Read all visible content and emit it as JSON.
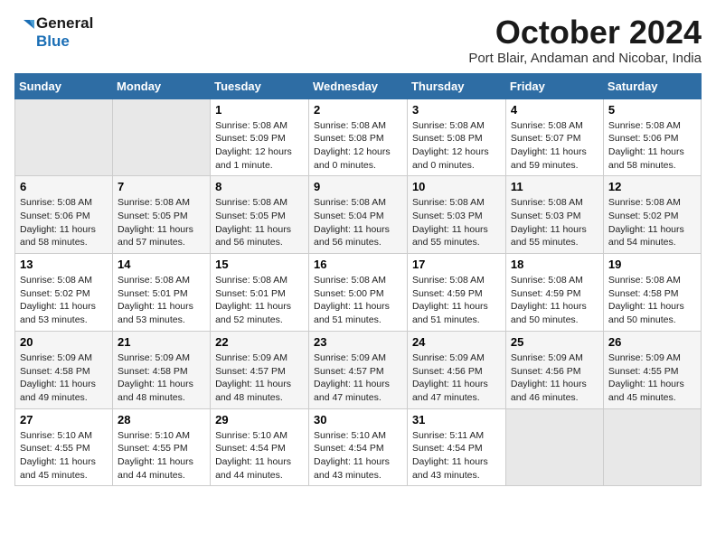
{
  "logo": {
    "line1": "General",
    "line2": "Blue"
  },
  "title": "October 2024",
  "subtitle": "Port Blair, Andaman and Nicobar, India",
  "days_header": [
    "Sunday",
    "Monday",
    "Tuesday",
    "Wednesday",
    "Thursday",
    "Friday",
    "Saturday"
  ],
  "weeks": [
    [
      {
        "day": "",
        "info": ""
      },
      {
        "day": "",
        "info": ""
      },
      {
        "day": "1",
        "info": "Sunrise: 5:08 AM\nSunset: 5:09 PM\nDaylight: 12 hours\nand 1 minute."
      },
      {
        "day": "2",
        "info": "Sunrise: 5:08 AM\nSunset: 5:08 PM\nDaylight: 12 hours\nand 0 minutes."
      },
      {
        "day": "3",
        "info": "Sunrise: 5:08 AM\nSunset: 5:08 PM\nDaylight: 12 hours\nand 0 minutes."
      },
      {
        "day": "4",
        "info": "Sunrise: 5:08 AM\nSunset: 5:07 PM\nDaylight: 11 hours\nand 59 minutes."
      },
      {
        "day": "5",
        "info": "Sunrise: 5:08 AM\nSunset: 5:06 PM\nDaylight: 11 hours\nand 58 minutes."
      }
    ],
    [
      {
        "day": "6",
        "info": "Sunrise: 5:08 AM\nSunset: 5:06 PM\nDaylight: 11 hours\nand 58 minutes."
      },
      {
        "day": "7",
        "info": "Sunrise: 5:08 AM\nSunset: 5:05 PM\nDaylight: 11 hours\nand 57 minutes."
      },
      {
        "day": "8",
        "info": "Sunrise: 5:08 AM\nSunset: 5:05 PM\nDaylight: 11 hours\nand 56 minutes."
      },
      {
        "day": "9",
        "info": "Sunrise: 5:08 AM\nSunset: 5:04 PM\nDaylight: 11 hours\nand 56 minutes."
      },
      {
        "day": "10",
        "info": "Sunrise: 5:08 AM\nSunset: 5:03 PM\nDaylight: 11 hours\nand 55 minutes."
      },
      {
        "day": "11",
        "info": "Sunrise: 5:08 AM\nSunset: 5:03 PM\nDaylight: 11 hours\nand 55 minutes."
      },
      {
        "day": "12",
        "info": "Sunrise: 5:08 AM\nSunset: 5:02 PM\nDaylight: 11 hours\nand 54 minutes."
      }
    ],
    [
      {
        "day": "13",
        "info": "Sunrise: 5:08 AM\nSunset: 5:02 PM\nDaylight: 11 hours\nand 53 minutes."
      },
      {
        "day": "14",
        "info": "Sunrise: 5:08 AM\nSunset: 5:01 PM\nDaylight: 11 hours\nand 53 minutes."
      },
      {
        "day": "15",
        "info": "Sunrise: 5:08 AM\nSunset: 5:01 PM\nDaylight: 11 hours\nand 52 minutes."
      },
      {
        "day": "16",
        "info": "Sunrise: 5:08 AM\nSunset: 5:00 PM\nDaylight: 11 hours\nand 51 minutes."
      },
      {
        "day": "17",
        "info": "Sunrise: 5:08 AM\nSunset: 4:59 PM\nDaylight: 11 hours\nand 51 minutes."
      },
      {
        "day": "18",
        "info": "Sunrise: 5:08 AM\nSunset: 4:59 PM\nDaylight: 11 hours\nand 50 minutes."
      },
      {
        "day": "19",
        "info": "Sunrise: 5:08 AM\nSunset: 4:58 PM\nDaylight: 11 hours\nand 50 minutes."
      }
    ],
    [
      {
        "day": "20",
        "info": "Sunrise: 5:09 AM\nSunset: 4:58 PM\nDaylight: 11 hours\nand 49 minutes."
      },
      {
        "day": "21",
        "info": "Sunrise: 5:09 AM\nSunset: 4:58 PM\nDaylight: 11 hours\nand 48 minutes."
      },
      {
        "day": "22",
        "info": "Sunrise: 5:09 AM\nSunset: 4:57 PM\nDaylight: 11 hours\nand 48 minutes."
      },
      {
        "day": "23",
        "info": "Sunrise: 5:09 AM\nSunset: 4:57 PM\nDaylight: 11 hours\nand 47 minutes."
      },
      {
        "day": "24",
        "info": "Sunrise: 5:09 AM\nSunset: 4:56 PM\nDaylight: 11 hours\nand 47 minutes."
      },
      {
        "day": "25",
        "info": "Sunrise: 5:09 AM\nSunset: 4:56 PM\nDaylight: 11 hours\nand 46 minutes."
      },
      {
        "day": "26",
        "info": "Sunrise: 5:09 AM\nSunset: 4:55 PM\nDaylight: 11 hours\nand 45 minutes."
      }
    ],
    [
      {
        "day": "27",
        "info": "Sunrise: 5:10 AM\nSunset: 4:55 PM\nDaylight: 11 hours\nand 45 minutes."
      },
      {
        "day": "28",
        "info": "Sunrise: 5:10 AM\nSunset: 4:55 PM\nDaylight: 11 hours\nand 44 minutes."
      },
      {
        "day": "29",
        "info": "Sunrise: 5:10 AM\nSunset: 4:54 PM\nDaylight: 11 hours\nand 44 minutes."
      },
      {
        "day": "30",
        "info": "Sunrise: 5:10 AM\nSunset: 4:54 PM\nDaylight: 11 hours\nand 43 minutes."
      },
      {
        "day": "31",
        "info": "Sunrise: 5:11 AM\nSunset: 4:54 PM\nDaylight: 11 hours\nand 43 minutes."
      },
      {
        "day": "",
        "info": ""
      },
      {
        "day": "",
        "info": ""
      }
    ]
  ]
}
